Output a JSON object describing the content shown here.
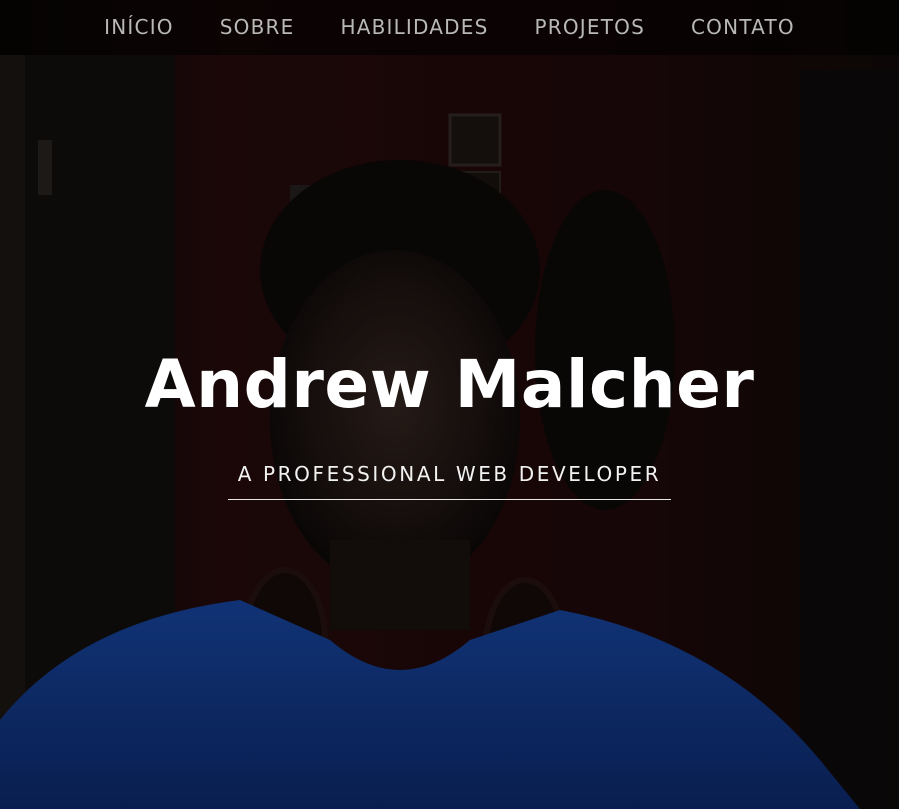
{
  "nav": {
    "items": [
      {
        "label": "INÍCIO"
      },
      {
        "label": "SOBRE"
      },
      {
        "label": "HABILIDADES"
      },
      {
        "label": "PROJETOS"
      },
      {
        "label": "CONTATO"
      }
    ]
  },
  "hero": {
    "name": "Andrew Malcher",
    "tagline": "A PROFESSIONAL WEB DEVELOPER"
  },
  "colors": {
    "nav_text": "#b8b8b8",
    "hero_text": "#ffffff",
    "shirt": "#1a4fb5",
    "background_wall": "#2a0a0c"
  }
}
